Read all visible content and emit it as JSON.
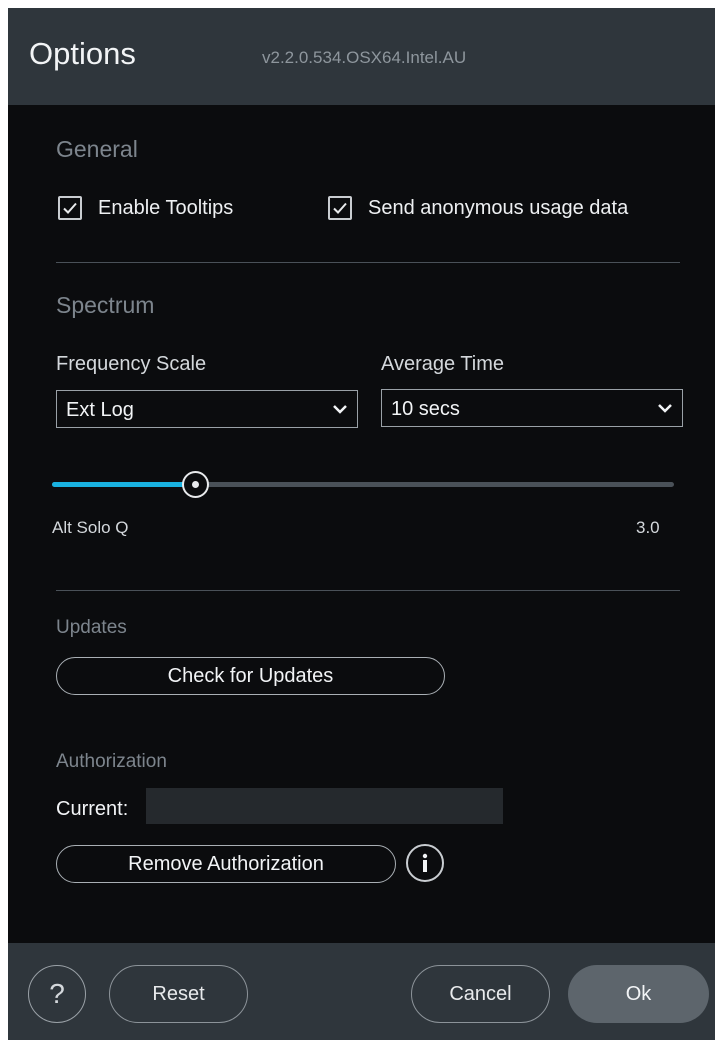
{
  "header": {
    "title": "Options",
    "version": "v2.2.0.534.OSX64.Intel.AU"
  },
  "general": {
    "heading": "General",
    "tooltips": {
      "label": "Enable Tooltips",
      "checked": true
    },
    "usage": {
      "label": "Send anonymous usage data",
      "checked": true
    }
  },
  "spectrum": {
    "heading": "Spectrum",
    "frequency_scale": {
      "label": "Frequency Scale",
      "value": "Ext Log"
    },
    "average_time": {
      "label": "Average Time",
      "value": "10 secs"
    },
    "alt_solo_q": {
      "label": "Alt Solo Q",
      "value": "3.0",
      "fill_fraction": 0.23
    }
  },
  "updates": {
    "heading": "Updates",
    "check_label": "Check for Updates"
  },
  "authorization": {
    "heading": "Authorization",
    "current_label": "Current:",
    "current_value": "",
    "remove_label": "Remove Authorization",
    "info_icon": "info-icon"
  },
  "footer": {
    "help_glyph": "?",
    "reset_label": "Reset",
    "cancel_label": "Cancel",
    "ok_label": "Ok"
  },
  "colors": {
    "background": "#0b0c0e",
    "panel": "#2f363c",
    "accent": "#19b2e0",
    "ok_button": "#5d656c"
  }
}
